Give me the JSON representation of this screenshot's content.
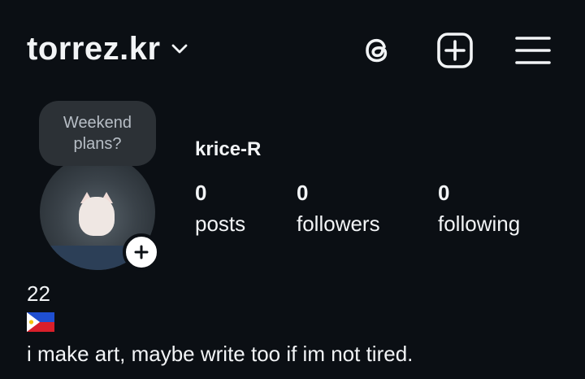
{
  "header": {
    "username": "torrez.kr",
    "icons": [
      "chevron-down-icon",
      "threads-icon",
      "create-plus-icon",
      "hamburger-menu-icon"
    ]
  },
  "note": {
    "text": "Weekend plans?"
  },
  "profile": {
    "display_name": "krice-R",
    "stats": [
      {
        "value": "0",
        "label": "posts"
      },
      {
        "value": "0",
        "label": "followers"
      },
      {
        "value": "0",
        "label": "following"
      }
    ]
  },
  "bio": {
    "age": "22",
    "flag": "philippines-flag-icon",
    "line": "i make art, maybe write too if im not tired."
  },
  "colors": {
    "background": "#0b0f14",
    "text": "#f2f4f6",
    "note_bubble": "#2c3136",
    "note_text": "#b7bec6"
  }
}
